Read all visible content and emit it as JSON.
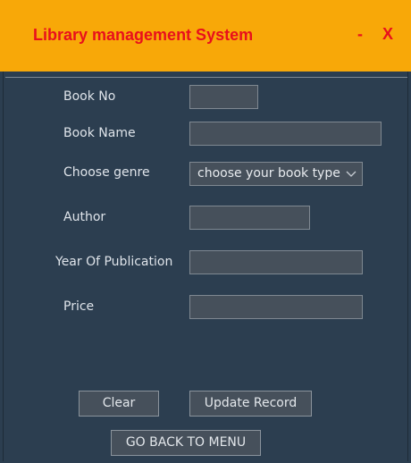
{
  "window": {
    "title": "Library management System",
    "minimize_label": "-",
    "close_label": "X"
  },
  "form": {
    "book_no_label": "Book No",
    "book_no_value": "",
    "book_name_label": "Book Name",
    "book_name_value": "",
    "genre_label": "Choose genre",
    "genre_selected": "choose your book type",
    "author_label": "Author",
    "author_value": "",
    "year_label": "Year Of Publication",
    "year_value": "",
    "price_label": "Price",
    "price_value": ""
  },
  "buttons": {
    "clear": "Clear",
    "update": "Update Record",
    "back": "GO BACK TO MENU"
  },
  "colors": {
    "titlebar": "#f8a808",
    "title_text": "#e8101c",
    "background": "#2c3e50",
    "field_bg": "#46505b"
  }
}
